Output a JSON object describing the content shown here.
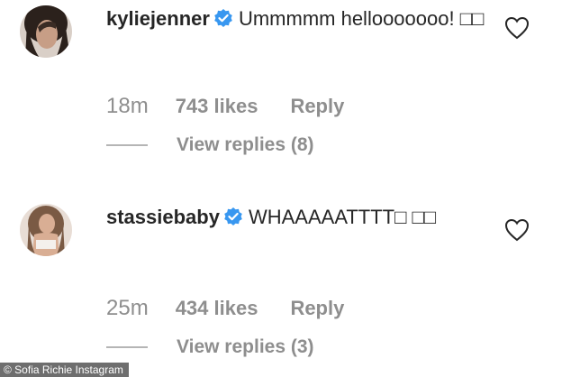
{
  "comments": [
    {
      "username": "kyliejenner",
      "text": "Ummmmm hellooooooo! □□",
      "time": "18m",
      "likes": "743 likes",
      "reply": "Reply",
      "view_replies": "View replies (8)"
    },
    {
      "username": "stassiebaby",
      "text": "WHAAAAATTTT□ □□",
      "time": "25m",
      "likes": "434 likes",
      "reply": "Reply",
      "view_replies": "View replies (3)"
    }
  ],
  "credit": "© Sofia Richie Instagram",
  "colors": {
    "verified": "#3897f0",
    "muted": "#8e8e8e",
    "text": "#262626"
  },
  "icons": {
    "verified": "verified-badge-icon",
    "like": "heart-icon"
  }
}
